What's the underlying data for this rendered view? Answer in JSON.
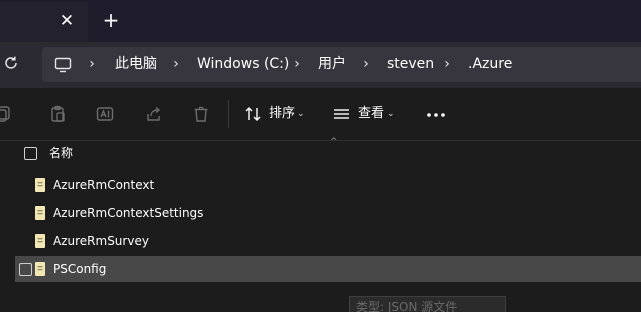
{
  "tab": {
    "close_glyph": "✕",
    "new_tab_glyph": "+"
  },
  "breadcrumb": {
    "separator": "›",
    "items": [
      {
        "label": "此电脑"
      },
      {
        "label": "Windows (C:)"
      },
      {
        "label": "用户"
      },
      {
        "label": "steven"
      },
      {
        "label": ".Azure"
      }
    ]
  },
  "toolbar": {
    "sort_label": "排序",
    "view_label": "查看",
    "dropdown_glyph": "⌄",
    "more_icon": "more-horizontal-icon"
  },
  "list": {
    "sort_caret": "^",
    "header": {
      "name_label": "名称"
    },
    "files": [
      {
        "name": "AzureRmContext",
        "selected": false
      },
      {
        "name": "AzureRmContextSettings",
        "selected": false
      },
      {
        "name": "AzureRmSurvey",
        "selected": false
      },
      {
        "name": "PSConfig",
        "selected": true
      }
    ]
  },
  "tooltip": {
    "text": "类型: JSON 源文件"
  },
  "colors": {
    "tab_strip": "#1f1c2c",
    "address_row": "#2b2a33",
    "address_bar": "#37363f",
    "background": "#1c1c1c",
    "selected_row": "#484848",
    "file_icon": "#f2e7b2"
  }
}
